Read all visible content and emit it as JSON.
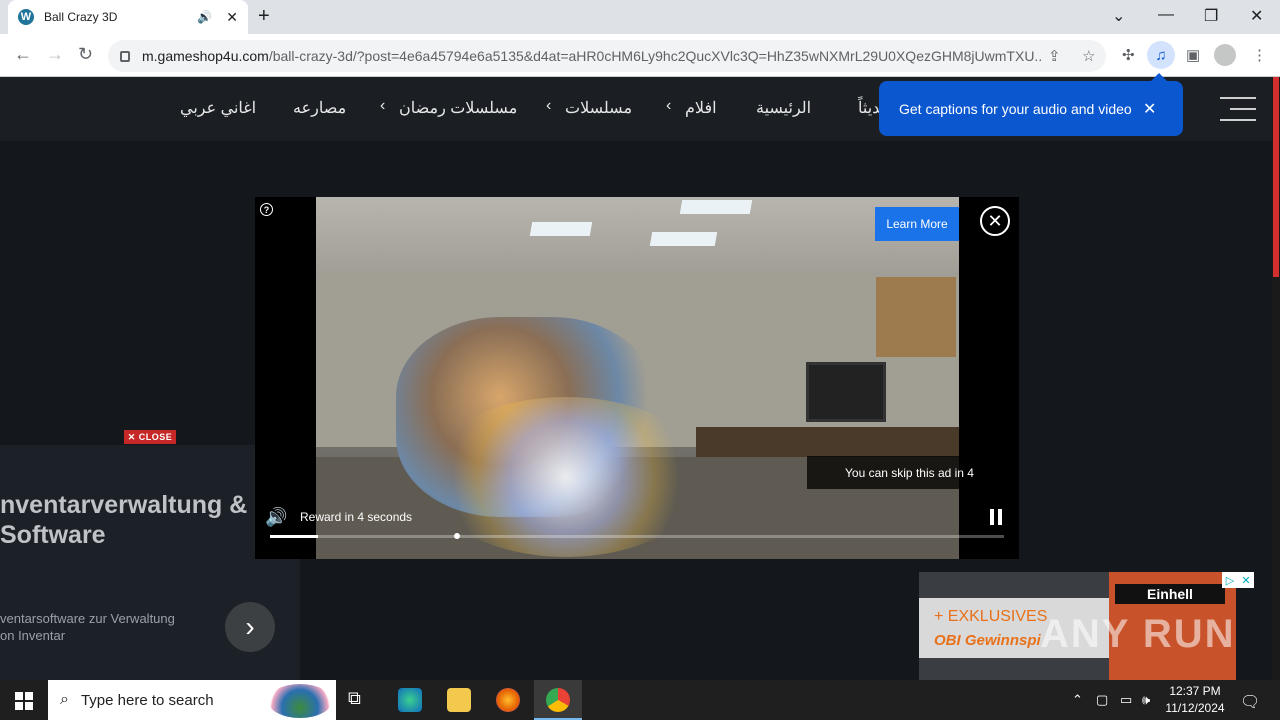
{
  "browser": {
    "tab_title": "Ball Crazy 3D",
    "tab_favicon_letter": "W",
    "new_tab": "+",
    "url_host": "m.gameshop4u.com",
    "url_path": "/ball-crazy-3d/?post=4e6a45794e6a5135&d4at=aHR0cHM6Ly9hc2QucXVlc3Q=HhZ35wNXMrL29U0XQezGHM8jUwmTXU..."
  },
  "site": {
    "nav_items": [
      "اغاني عربي",
      "مصارعه",
      "مسلسلات رمضان",
      "مسلسلات",
      "افلام",
      "الرئيسية",
      "جديثاً"
    ],
    "caption_popup": "Get captions for your audio and video"
  },
  "left_ad": {
    "close_label": "CLOSE",
    "headline_1": "nventarverwaltung &",
    "headline_2": "Software",
    "sub_1": "ventarsoftware zur Verwaltung",
    "sub_2": "on Inventar",
    "arrow": "›"
  },
  "video_ad": {
    "learn_more": "Learn More",
    "help": "?",
    "skip_text": "You can skip this ad in 4",
    "reward_text": "Reward in 4 seconds",
    "progress_fraction": 0.065,
    "position_fraction": 0.255
  },
  "right_ad": {
    "line1": "+ EXKLUSIVES",
    "line2": "OBI Gewinnspi",
    "brand": "Einhell",
    "watermark": "ANY RUN"
  },
  "taskbar": {
    "search_placeholder": "Type here to search",
    "time": "12:37 PM",
    "date": "11/12/2024"
  }
}
